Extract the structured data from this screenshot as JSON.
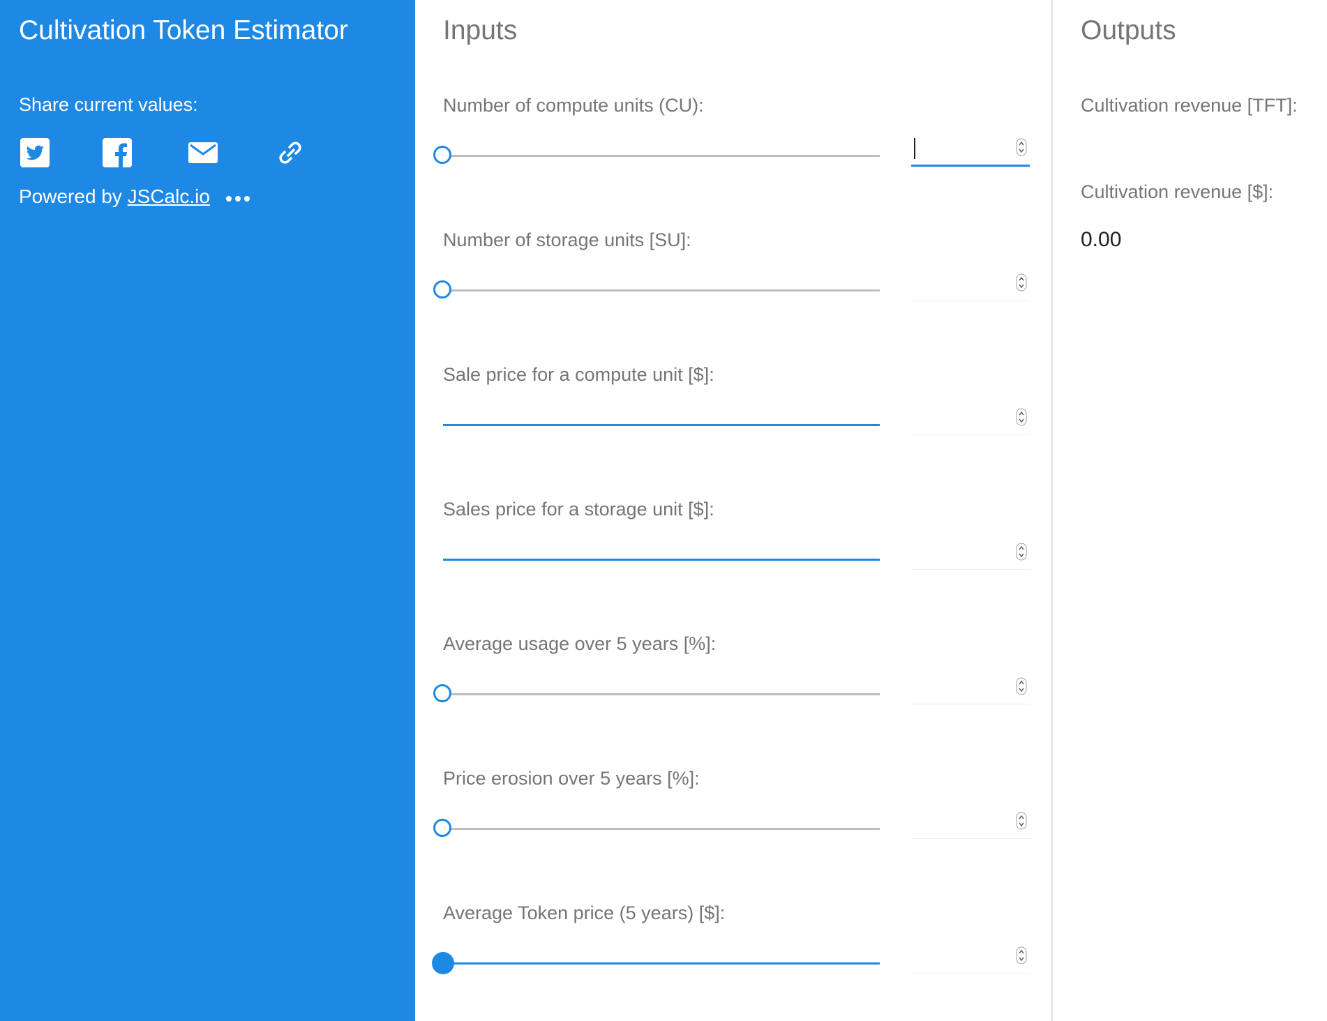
{
  "sidebar": {
    "title": "Cultivation Token Estimator",
    "share_label": "Share current values:",
    "share_icons": [
      "twitter-icon",
      "facebook-icon",
      "email-icon",
      "link-icon"
    ],
    "powered_prefix": "Powered by",
    "powered_link": "JSCalc.io",
    "more_icon": "more-dots-icon",
    "background_color": "#1e88e5"
  },
  "inputs": {
    "title": "Inputs",
    "fields": [
      {
        "label": "Number of compute units (CU):",
        "control": "slider",
        "value": "",
        "focused": true
      },
      {
        "label": "Number of storage units [SU]:",
        "control": "slider",
        "value": ""
      },
      {
        "label": "Sale price for a compute unit [$]:",
        "control": "line",
        "value": ""
      },
      {
        "label": "Sales price for a storage unit [$]:",
        "control": "line",
        "value": ""
      },
      {
        "label": "Average usage over 5 years [%]:",
        "control": "slider",
        "value": ""
      },
      {
        "label": "Price erosion over 5 years [%]:",
        "control": "slider",
        "value": ""
      },
      {
        "label": "Average Token price (5 years) [$]:",
        "control": "slider-active",
        "value": ""
      }
    ]
  },
  "outputs": {
    "title": "Outputs",
    "items": [
      {
        "label": "Cultivation revenue [TFT]:",
        "value": ""
      },
      {
        "label": "Cultivation revenue [$]:",
        "value": "0.00"
      }
    ]
  },
  "colors": {
    "accent": "#1e88e5",
    "label_gray": "#757575",
    "track_gray": "#bdbdbd"
  }
}
